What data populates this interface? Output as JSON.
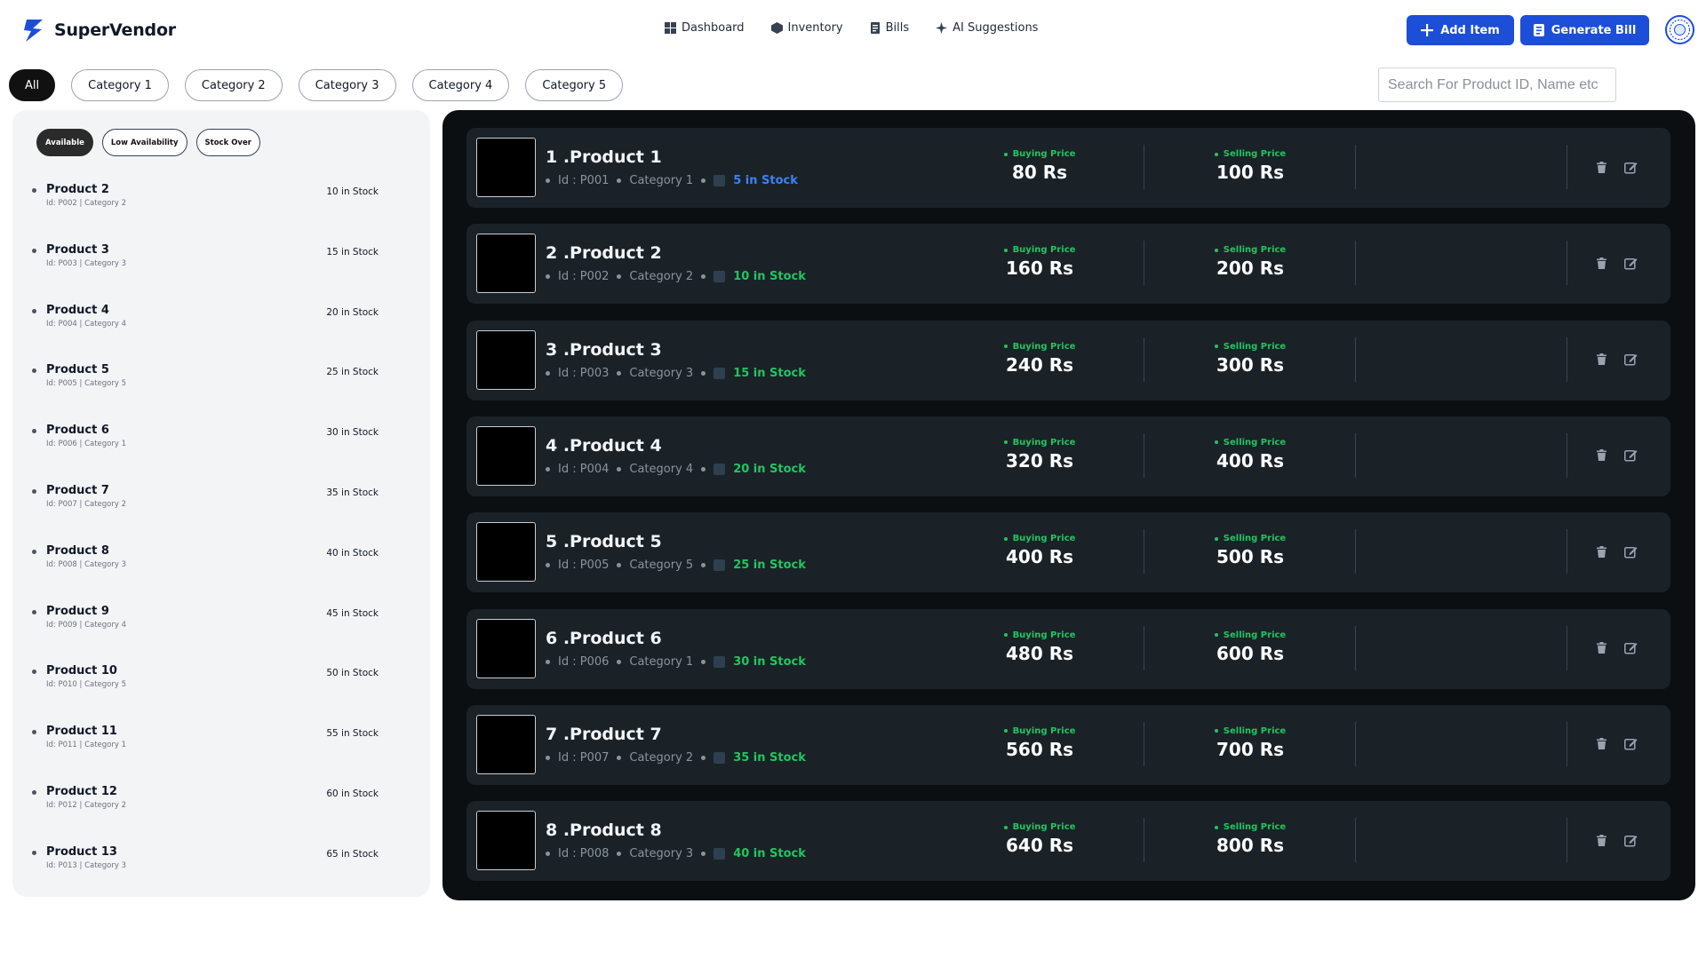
{
  "header": {
    "brand": "SuperVendor",
    "nav": [
      {
        "label": "Dashboard",
        "icon": "dashboard-icon"
      },
      {
        "label": "Inventory",
        "icon": "inventory-icon"
      },
      {
        "label": "Bills",
        "icon": "bills-icon"
      },
      {
        "label": "AI Suggestions",
        "icon": "sparkle-icon"
      }
    ],
    "add_item": "Add Item",
    "generate_bill": "Generate Bill"
  },
  "categories": [
    "All",
    "Category 1",
    "Category 2",
    "Category 3",
    "Category 4",
    "Category 5"
  ],
  "search": {
    "placeholder": "Search For Product ID, Name etc"
  },
  "stock_panel": {
    "filters": [
      "Available",
      "Low Availability",
      "Stock Over"
    ],
    "items": [
      {
        "name": "Product 2",
        "meta": "Id: P002 | Category 2",
        "qty": "10 in Stock"
      },
      {
        "name": "Product 3",
        "meta": "Id: P003 | Category 3",
        "qty": "15 in Stock"
      },
      {
        "name": "Product 4",
        "meta": "Id: P004 | Category 4",
        "qty": "20 in Stock"
      },
      {
        "name": "Product 5",
        "meta": "Id: P005 | Category 5",
        "qty": "25 in Stock"
      },
      {
        "name": "Product 6",
        "meta": "Id: P006 | Category 1",
        "qty": "30 in Stock"
      },
      {
        "name": "Product 7",
        "meta": "Id: P007 | Category 2",
        "qty": "35 in Stock"
      },
      {
        "name": "Product 8",
        "meta": "Id: P008 | Category 3",
        "qty": "40 in Stock"
      },
      {
        "name": "Product 9",
        "meta": "Id: P009 | Category 4",
        "qty": "45 in Stock"
      },
      {
        "name": "Product 10",
        "meta": "Id: P010 | Category 5",
        "qty": "50 in Stock"
      },
      {
        "name": "Product 11",
        "meta": "Id: P011 | Category 1",
        "qty": "55 in Stock"
      },
      {
        "name": "Product 12",
        "meta": "Id: P012 | Category 2",
        "qty": "60 in Stock"
      },
      {
        "name": "Product 13",
        "meta": "Id: P013 | Category 3",
        "qty": "65 in Stock"
      }
    ]
  },
  "products": {
    "buying_label": "Buying Price",
    "selling_label": "Selling Price",
    "items": [
      {
        "title": "1 .Product 1",
        "id": "Id : P001",
        "category": "Category 1",
        "stock": "5 in Stock",
        "buy": "80 Rs",
        "sell": "100 Rs",
        "low": true
      },
      {
        "title": "2 .Product 2",
        "id": "Id : P002",
        "category": "Category 2",
        "stock": "10 in Stock",
        "buy": "160 Rs",
        "sell": "200 Rs",
        "low": false
      },
      {
        "title": "3 .Product 3",
        "id": "Id : P003",
        "category": "Category 3",
        "stock": "15 in Stock",
        "buy": "240 Rs",
        "sell": "300 Rs",
        "low": false
      },
      {
        "title": "4 .Product 4",
        "id": "Id : P004",
        "category": "Category 4",
        "stock": "20 in Stock",
        "buy": "320 Rs",
        "sell": "400 Rs",
        "low": false
      },
      {
        "title": "5 .Product 5",
        "id": "Id : P005",
        "category": "Category 5",
        "stock": "25 in Stock",
        "buy": "400 Rs",
        "sell": "500 Rs",
        "low": false
      },
      {
        "title": "6 .Product 6",
        "id": "Id : P006",
        "category": "Category 1",
        "stock": "30 in Stock",
        "buy": "480 Rs",
        "sell": "600 Rs",
        "low": false
      },
      {
        "title": "7 .Product 7",
        "id": "Id : P007",
        "category": "Category 2",
        "stock": "35 in Stock",
        "buy": "560 Rs",
        "sell": "700 Rs",
        "low": false
      },
      {
        "title": "8 .Product 8",
        "id": "Id : P008",
        "category": "Category 3",
        "stock": "40 in Stock",
        "buy": "640 Rs",
        "sell": "800 Rs",
        "low": false
      }
    ]
  },
  "colors": {
    "accent": "#1d4ed8",
    "stock_green": "#22c55e",
    "stock_low_blue": "#3b82f6",
    "panel_dark": "#0b0f12"
  }
}
